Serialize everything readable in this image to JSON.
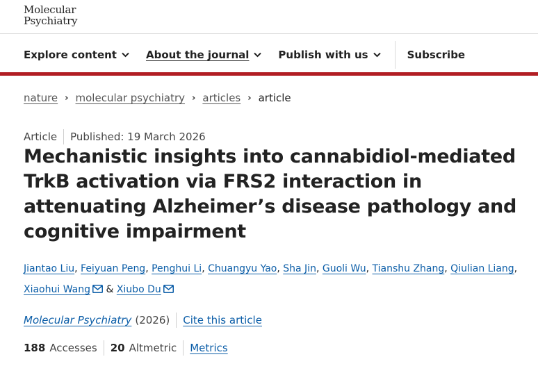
{
  "logo": {
    "line1": "Molecular",
    "line2": "Psychiatry"
  },
  "nav": {
    "items": [
      {
        "label": "Explore content"
      },
      {
        "label": "About the journal"
      },
      {
        "label": "Publish with us"
      }
    ],
    "subscribe": "Subscribe"
  },
  "breadcrumb": {
    "items": [
      "nature",
      "molecular psychiatry",
      "articles"
    ],
    "current": "article",
    "separator": "›"
  },
  "article": {
    "type": "Article",
    "published": "Published: 19 March 2026",
    "title": "Mechanistic insights into cannabidiol-mediated TrkB activation via FRS2 interaction in attenuating Alzheimer’s disease pathology and cognitive impairment",
    "authors": [
      "Jiantao Liu",
      "Feiyuan Peng",
      "Penghui Li",
      "Chuangyu Yao",
      "Sha Jin",
      "Guoli Wu",
      "Tianshu Zhang",
      "Qiulian Liang",
      "Xiaohui Wang",
      "Xiubo Du"
    ],
    "author_sep": ", ",
    "amp": " & ",
    "journal": "Molecular Psychiatry",
    "year": "(2026)",
    "cite": "Cite this article"
  },
  "metrics": {
    "accesses_count": "188",
    "accesses_label": "Accesses",
    "altmetric_count": "20",
    "altmetric_label": "Altmetric",
    "link": "Metrics"
  },
  "colors": {
    "brand_red": "#b21e23",
    "link_blue": "#0c5ea8"
  }
}
